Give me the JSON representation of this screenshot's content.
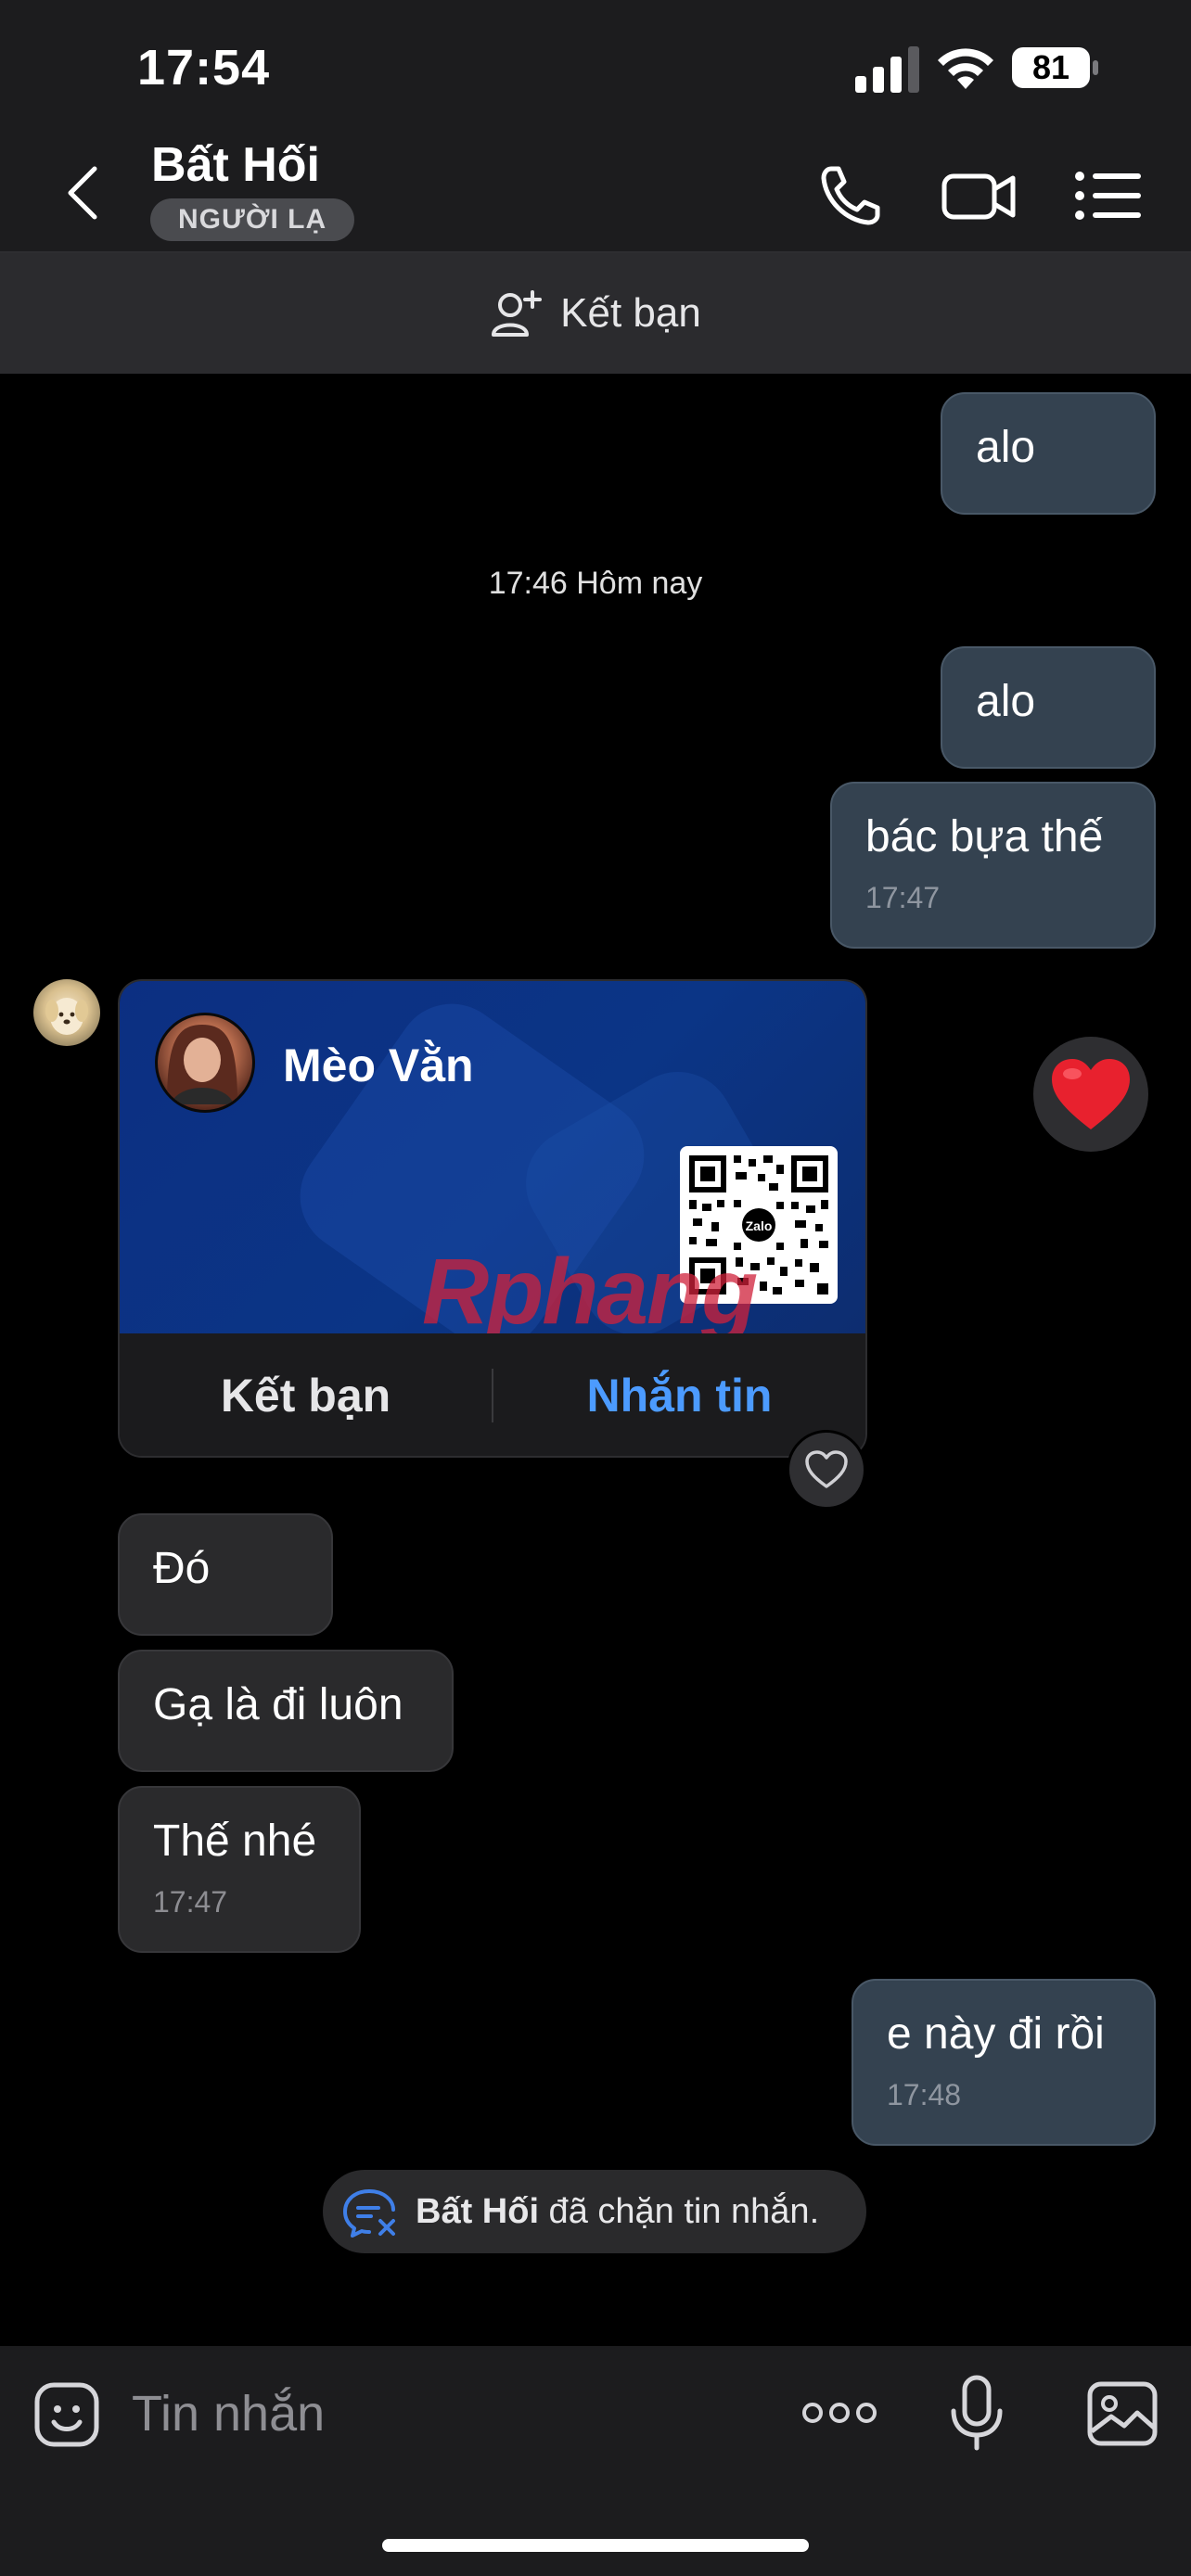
{
  "status_bar": {
    "time": "17:54",
    "battery": "81"
  },
  "header": {
    "title": "Bất Hối",
    "badge": "NGƯỜI LẠ",
    "icons": [
      "back-icon",
      "phone-icon",
      "video-call-icon",
      "menu-icon"
    ]
  },
  "friend_bar": {
    "label": "Kết bạn",
    "icon": "add-friend-icon"
  },
  "messages": {
    "m1": {
      "text": "alo"
    },
    "day_separator": "17:46 Hôm nay",
    "m2": {
      "text": "alo"
    },
    "m3": {
      "text": "bác bựa thế",
      "time": "17:47"
    },
    "card": {
      "name": "Mèo Vằn",
      "qr_label": "Zalo",
      "watermark": "Rphang",
      "add_friend": "Kết bạn",
      "message": "Nhắn tin",
      "reaction": "heart"
    },
    "m4": {
      "text": "Đó"
    },
    "m5": {
      "text": "Gạ là đi luôn"
    },
    "m6": {
      "text": "Thế nhé",
      "time": "17:47"
    },
    "m7": {
      "text": "e này đi rồi",
      "time": "17:48"
    }
  },
  "notice": {
    "name": "Bất Hối",
    "text": " đã chặn tin nhắn."
  },
  "composer": {
    "placeholder": "Tin nhắn",
    "icons": [
      "sticker-icon",
      "more-icon",
      "microphone-icon",
      "image-icon"
    ]
  },
  "colors": {
    "accent_blue": "#4c9bff",
    "outgoing_bubble": "#344250",
    "incoming_bubble": "#2a2a2c",
    "heart": "#e8212e"
  }
}
